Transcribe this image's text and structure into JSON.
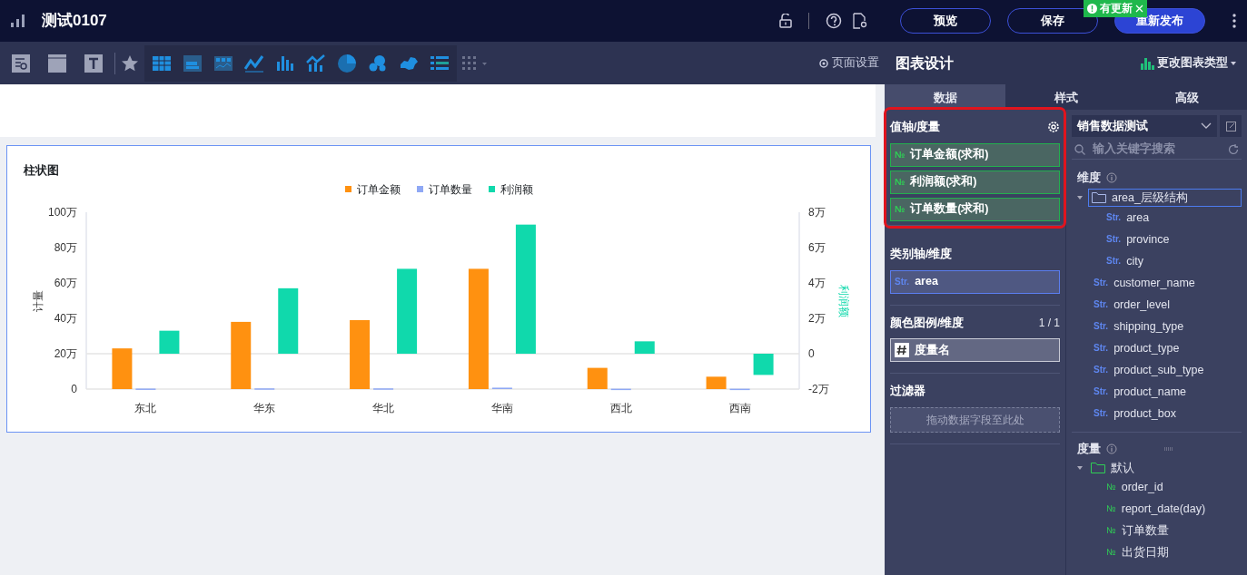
{
  "header": {
    "title": "测试0107",
    "buttons": [
      {
        "label": "预览",
        "kind": "outline"
      },
      {
        "label": "保存",
        "kind": "outline"
      },
      {
        "label": "重新发布",
        "kind": "primary"
      }
    ],
    "update_badge": "有更新"
  },
  "toolbar": {
    "page_settings": "页面设置"
  },
  "chart_card": {
    "title": "柱状图",
    "chart_data": {
      "type": "bar",
      "categories": [
        "东北",
        "华东",
        "华北",
        "华南",
        "西北",
        "西南"
      ],
      "ylabel": "计量",
      "y2label": "利润额",
      "stacked": false,
      "ylim": [
        0,
        100
      ],
      "y2lim": [
        -2,
        8
      ],
      "yticks": [
        {
          "value": 0,
          "label": "0"
        },
        {
          "value": 20,
          "label": "20万"
        },
        {
          "value": 40,
          "label": "40万"
        },
        {
          "value": 60,
          "label": "60万"
        },
        {
          "value": 80,
          "label": "80万"
        },
        {
          "value": 100,
          "label": "100万"
        }
      ],
      "y2ticks": [
        {
          "value": -2,
          "label": "-2万"
        },
        {
          "value": 0,
          "label": "0"
        },
        {
          "value": 2,
          "label": "2万"
        },
        {
          "value": 4,
          "label": "4万"
        },
        {
          "value": 6,
          "label": "6万"
        },
        {
          "value": 8,
          "label": "8万"
        }
      ],
      "series": [
        {
          "name": "订单金额",
          "color": "#ff9110",
          "values": [
            23,
            38,
            39,
            68,
            12,
            7
          ]
        },
        {
          "name": "订单数量",
          "color": "#8fa8f5",
          "values": [
            0.3,
            0.4,
            0.4,
            0.8,
            0.2,
            0.2
          ]
        },
        {
          "name": "利润额",
          "color": "#10d9ac",
          "axis": "y2",
          "values": [
            1.3,
            3.7,
            4.8,
            7.3,
            0.7,
            -1.2
          ]
        }
      ]
    }
  },
  "designer": {
    "title": "图表设计",
    "change_type": "更改图表类型",
    "tabs": [
      {
        "label": "数据",
        "selected": true
      },
      {
        "label": "样式",
        "selected": false
      },
      {
        "label": "高级",
        "selected": false
      }
    ],
    "wells": [
      {
        "label": "值轴/度量",
        "highlighted": true,
        "fields": [
          {
            "kind": "measure",
            "tag": "№",
            "name": "订单金额(求和)"
          },
          {
            "kind": "measure",
            "tag": "№",
            "name": "利润额(求和)"
          },
          {
            "kind": "measure",
            "tag": "№",
            "name": "订单数量(求和)"
          }
        ]
      },
      {
        "label": "类别轴/维度",
        "highlighted": false,
        "fields": [
          {
            "kind": "dimension",
            "tag": "Str.",
            "name": "area"
          }
        ]
      },
      {
        "label": "颜色图例/维度",
        "highlighted": false,
        "count": "1 / 1",
        "fields": [
          {
            "kind": "measure-name",
            "name": "度量名"
          }
        ]
      },
      {
        "label": "过滤器",
        "highlighted": false,
        "placeholder": "拖动数据字段至此处"
      }
    ],
    "dataset": {
      "name": "销售数据测试",
      "search_placeholder": "输入关键字搜索",
      "groups": [
        {
          "label": "维度",
          "kind": "dimension",
          "items": [
            {
              "kind": "folder",
              "name": "area_层级结构",
              "expanded": true,
              "selected": true,
              "children": [
                {
                  "kind": "field",
                  "tag": "Str.",
                  "name": "area"
                },
                {
                  "kind": "field",
                  "tag": "Str.",
                  "name": "province"
                },
                {
                  "kind": "field",
                  "tag": "Str.",
                  "name": "city"
                }
              ]
            },
            {
              "kind": "field",
              "tag": "Str.",
              "name": "customer_name"
            },
            {
              "kind": "field",
              "tag": "Str.",
              "name": "order_level"
            },
            {
              "kind": "field",
              "tag": "Str.",
              "name": "shipping_type"
            },
            {
              "kind": "field",
              "tag": "Str.",
              "name": "product_type"
            },
            {
              "kind": "field",
              "tag": "Str.",
              "name": "product_sub_type"
            },
            {
              "kind": "field",
              "tag": "Str.",
              "name": "product_name"
            },
            {
              "kind": "field",
              "tag": "Str.",
              "name": "product_box"
            }
          ]
        },
        {
          "label": "度量",
          "kind": "measure",
          "items": [
            {
              "kind": "folder",
              "name": "默认",
              "expanded": true,
              "selected": false,
              "children": [
                {
                  "kind": "field",
                  "tag": "№",
                  "name": "order_id"
                },
                {
                  "kind": "field",
                  "tag": "№",
                  "name": "report_date(day)"
                },
                {
                  "kind": "field",
                  "tag": "№",
                  "name": "订单数量"
                },
                {
                  "kind": "field",
                  "tag": "№",
                  "name": "出货日期"
                }
              ]
            }
          ]
        }
      ]
    }
  }
}
